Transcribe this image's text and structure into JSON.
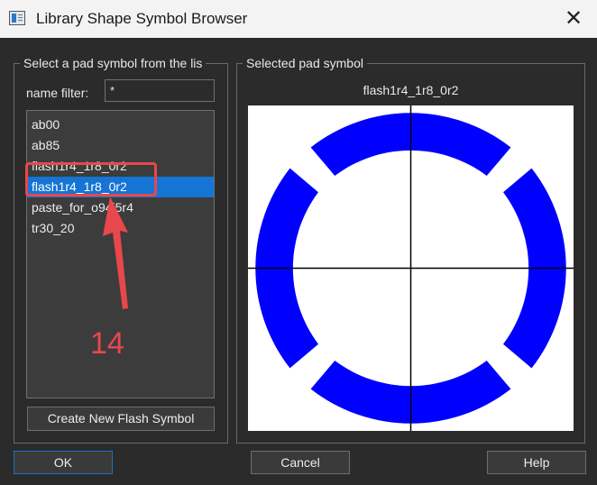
{
  "window": {
    "title": "Library Shape Symbol Browser",
    "close_glyph": "✕"
  },
  "left_panel": {
    "legend": "Select a pad symbol from the lis",
    "filter_label": "name filter:",
    "filter_value": "*",
    "items": [
      "ab00",
      "ab85",
      "flash1r4_1r8_0r2",
      "flash1r4_1r8_0r2",
      "paste_for_o94i5r4",
      "tr30_20"
    ],
    "selected_index": 3,
    "create_button": "Create New Flash Symbol"
  },
  "right_panel": {
    "legend": "Selected pad symbol",
    "symbol_name": "flash1r4_1r8_0r2",
    "shape_color": "#0000ff",
    "crosshair_color": "#000000",
    "canvas_color": "#ffffff"
  },
  "buttons": {
    "ok": "OK",
    "cancel": "Cancel",
    "help": "Help"
  },
  "annotation": {
    "number": "14",
    "color": "#e8474c"
  }
}
